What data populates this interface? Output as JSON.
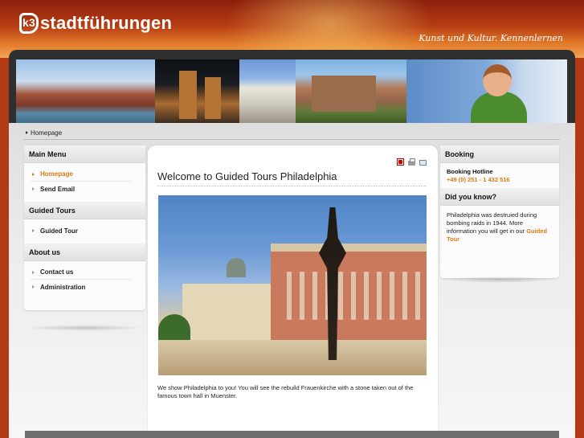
{
  "header": {
    "logo_mark": "k3",
    "logo_text": "stadtführungen",
    "tagline": "Kunst und Kultur. Kennenlernen"
  },
  "breadcrumb": {
    "current": "Homepage"
  },
  "left_sidebar": {
    "main_menu": {
      "title": "Main Menu",
      "items": [
        {
          "label": "Homepage",
          "active": true
        },
        {
          "label": "Send Email",
          "active": false
        }
      ]
    },
    "guided_tours": {
      "title": "Guided Tours",
      "items": [
        {
          "label": "Guided Tour"
        }
      ]
    },
    "about_us": {
      "title": "About us",
      "items": [
        {
          "label": "Contact us"
        },
        {
          "label": "Administration"
        }
      ]
    }
  },
  "article": {
    "title": "Welcome to Guided Tours Philadelphia",
    "intro": "We show Philadelphia to you! You will see the rebuild Frauenkirche with a stone taken out of the famous town hall in Muenster.",
    "icons": [
      "pdf-icon",
      "print-icon",
      "email-icon"
    ]
  },
  "right_sidebar": {
    "booking": {
      "title": "Booking",
      "hotline_label": "Booking Hotline",
      "hotline_phone": "+49 (0) 251 - 1 432 516"
    },
    "did_you_know": {
      "title": "Did you know?",
      "text": "Philadelphia was destruied during bombing raids in 1944. More information you will get in our ",
      "link": "Guided Tour"
    }
  },
  "colors": {
    "accent_orange": "#e07a10",
    "header_red": "#b13a14"
  }
}
